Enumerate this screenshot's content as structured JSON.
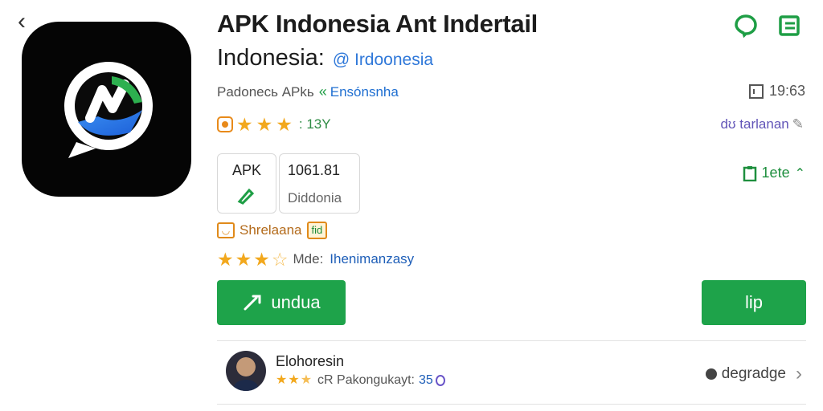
{
  "nav": {
    "back_icon": "‹"
  },
  "app": {
    "title": "APK Indonesia Ant Indertail",
    "subtitle": "Indonesia:",
    "tag": "@ Irdoonesia",
    "developer_label": "Padonесь APkь",
    "developer_link": "Ensónsnha",
    "time": "19:63",
    "rating_count": ": 13Y",
    "kategori": "dʊ tarlanan"
  },
  "cards": {
    "card1_top": "APK",
    "card2_top": "1061.81",
    "card2_bottom": "Diddonia"
  },
  "aside_link": "1ete",
  "tags": {
    "label": "Shrelaana",
    "pill": "fid"
  },
  "rate2": {
    "label": "Mde:",
    "value": "Ihenimanzasy"
  },
  "buttons": {
    "main": "undua",
    "side": "lip"
  },
  "review": {
    "name": "Elohoresin",
    "label": "cR Pakongukayt:",
    "count": "35",
    "update": "degradge"
  },
  "colors": {
    "accent_green": "#1ea34a",
    "link_blue": "#1f6fd1",
    "star": "#f2a81d"
  }
}
